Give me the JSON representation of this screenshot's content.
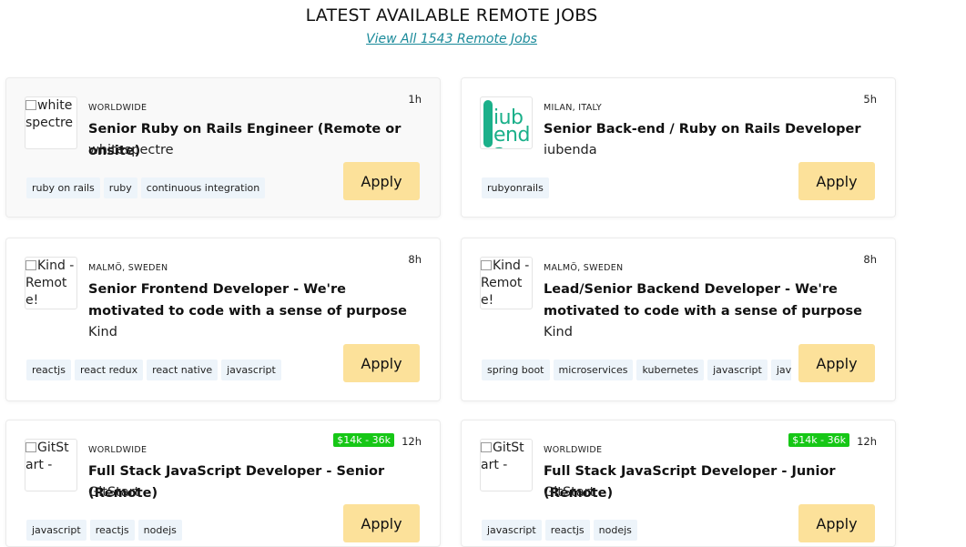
{
  "header": {
    "title": "LATEST AVAILABLE REMOTE JOBS",
    "view_all": "View All 1543 Remote Jobs"
  },
  "jobs": [
    {
      "location": "WORLDWIDE",
      "time": "1h",
      "salary": "",
      "title": "Senior Ruby on Rails Engineer (Remote or onsite)",
      "company": "whitespectre",
      "logo_alt": "whitespectre",
      "tags": [
        "ruby on rails",
        "ruby",
        "continuous integration"
      ],
      "apply": "Apply"
    },
    {
      "location": "MILAN, ITALY",
      "time": "5h",
      "salary": "",
      "title": "Senior Back-end / Ruby on Rails Developer",
      "company": "iubenda",
      "logo_text": "iubenda",
      "tags": [
        "rubyonrails"
      ],
      "apply": "Apply"
    },
    {
      "location": "MALMÖ, SWEDEN",
      "time": "8h",
      "salary": "",
      "title": "Senior Frontend Developer - We're motivated to code with a sense of purpose",
      "company": "Kind",
      "logo_alt": "Kind - Remote!",
      "tags": [
        "reactjs",
        "react redux",
        "react native",
        "javascript"
      ],
      "apply": "Apply"
    },
    {
      "location": "MALMÖ, SWEDEN",
      "time": "8h",
      "salary": "",
      "title": "Lead/Senior Backend Developer - We're motivated to code with a sense of purpose",
      "company": "Kind",
      "logo_alt": "Kind - Remote!",
      "tags": [
        "spring boot",
        "microservices",
        "kubernetes",
        "javascript",
        "java"
      ],
      "apply": "Apply"
    },
    {
      "location": "WORLDWIDE",
      "time": "12h",
      "salary": "$14k - 36k",
      "title": "Full Stack JavaScript Developer - Senior (Remote)",
      "company": "GitStart",
      "logo_alt": "GitStart -",
      "tags": [
        "javascript",
        "reactjs",
        "nodejs"
      ],
      "apply": "Apply"
    },
    {
      "location": "WORLDWIDE",
      "time": "12h",
      "salary": "$14k - 36k",
      "title": "Full Stack JavaScript Developer - Junior (Remote)",
      "company": "GitStart",
      "logo_alt": "GitStart -",
      "tags": [
        "javascript",
        "reactjs",
        "nodejs"
      ],
      "apply": "Apply"
    }
  ],
  "colors": {
    "apply_bg": "#fce19a",
    "tag_bg": "#edf4fa",
    "salary_bg": "#16c716",
    "link": "#1a8a9a",
    "iubenda_brand": "#1bb08a"
  }
}
